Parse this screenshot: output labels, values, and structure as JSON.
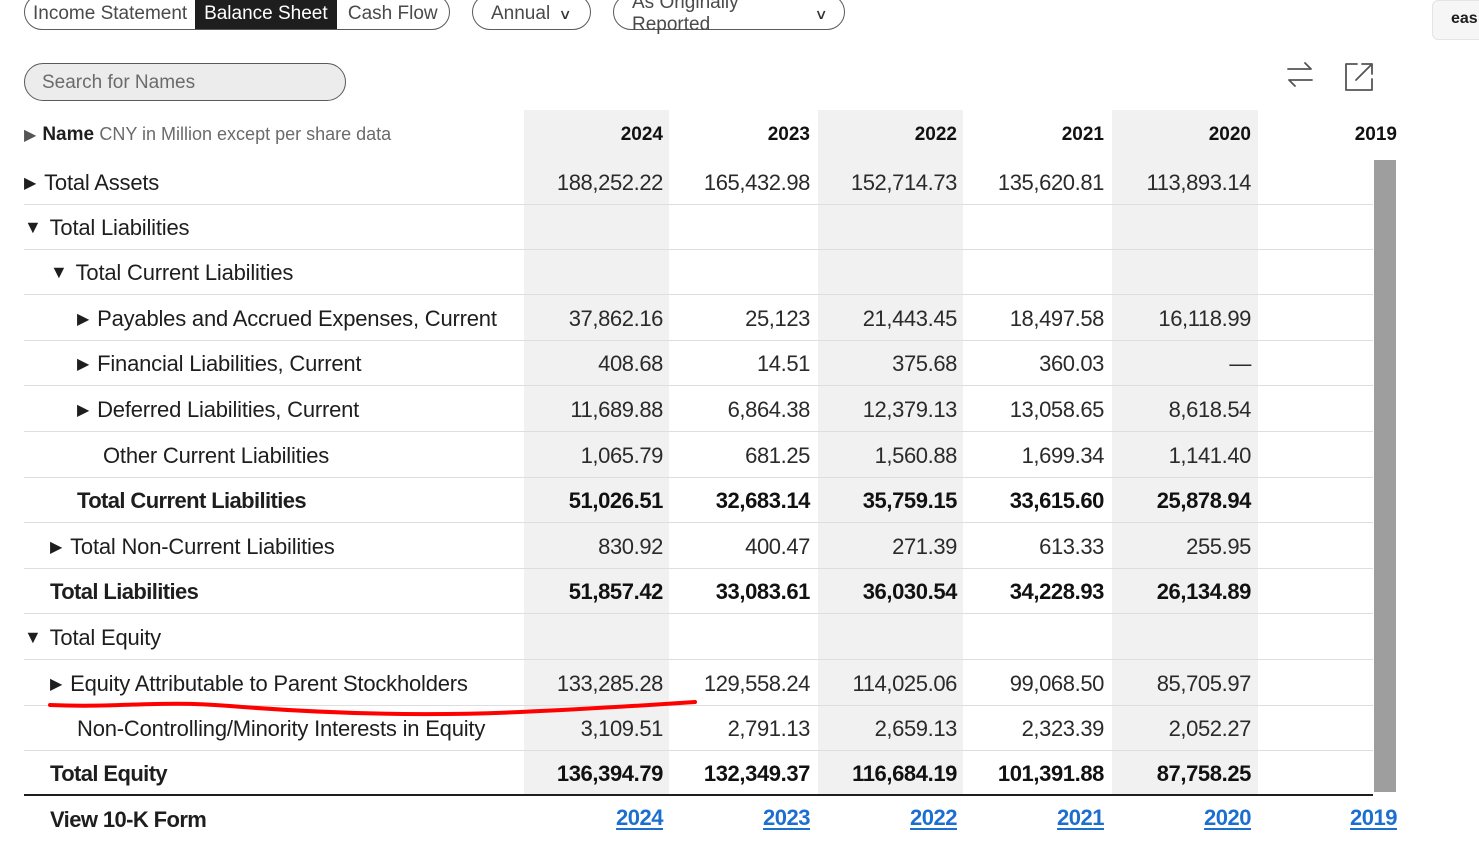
{
  "tabs": [
    {
      "label": "Income Statement",
      "active": false
    },
    {
      "label": "Balance Sheet",
      "active": true
    },
    {
      "label": "Cash Flow",
      "active": false
    }
  ],
  "period_dropdown": {
    "value": "Annual"
  },
  "report_dropdown": {
    "value": "As Originally Reported"
  },
  "corner_button": {
    "label": "eas"
  },
  "search": {
    "placeholder": "Search for Names"
  },
  "icons": {
    "swap": "swap-arrows-icon",
    "export": "external-link-icon"
  },
  "table": {
    "header": {
      "name_label": "Name",
      "units": "CNY in Million except per share data"
    },
    "years": [
      "2024",
      "2023",
      "2022",
      "2021",
      "2020",
      "2019"
    ],
    "rows": [
      {
        "label": "Total Assets",
        "values": [
          "188,252.22",
          "165,432.98",
          "152,714.73",
          "135,620.81",
          "113,893.14"
        ]
      },
      {
        "label": "Total Liabilities",
        "values": [
          "",
          "",
          "",
          "",
          ""
        ]
      },
      {
        "label": "Total Current Liabilities",
        "values": [
          "",
          "",
          "",
          "",
          ""
        ]
      },
      {
        "label": "Payables and Accrued Expenses, Current",
        "values": [
          "37,862.16",
          "25,123",
          "21,443.45",
          "18,497.58",
          "16,118.99"
        ]
      },
      {
        "label": "Financial Liabilities, Current",
        "values": [
          "408.68",
          "14.51",
          "375.68",
          "360.03",
          "—"
        ]
      },
      {
        "label": "Deferred Liabilities, Current",
        "values": [
          "11,689.88",
          "6,864.38",
          "12,379.13",
          "13,058.65",
          "8,618.54"
        ]
      },
      {
        "label": "Other Current Liabilities",
        "values": [
          "1,065.79",
          "681.25",
          "1,560.88",
          "1,699.34",
          "1,141.40"
        ]
      },
      {
        "label": "Total Current Liabilities",
        "values": [
          "51,026.51",
          "32,683.14",
          "35,759.15",
          "33,615.60",
          "25,878.94"
        ]
      },
      {
        "label": "Total Non-Current Liabilities",
        "values": [
          "830.92",
          "400.47",
          "271.39",
          "613.33",
          "255.95"
        ]
      },
      {
        "label": "Total Liabilities",
        "values": [
          "51,857.42",
          "33,083.61",
          "36,030.54",
          "34,228.93",
          "26,134.89"
        ]
      },
      {
        "label": "Total Equity",
        "values": [
          "",
          "",
          "",
          "",
          ""
        ]
      },
      {
        "label": "Equity Attributable to Parent Stockholders",
        "values": [
          "133,285.28",
          "129,558.24",
          "114,025.06",
          "99,068.50",
          "85,705.97"
        ]
      },
      {
        "label": "Non-Controlling/Minority Interests in Equity",
        "values": [
          "3,109.51",
          "2,791.13",
          "2,659.13",
          "2,323.39",
          "2,052.27"
        ]
      },
      {
        "label": "Total Equity",
        "values": [
          "136,394.79",
          "132,349.37",
          "116,684.19",
          "101,391.88",
          "87,758.25"
        ]
      }
    ],
    "footer": {
      "label": "View 10-K Form",
      "links": [
        "2024",
        "2023",
        "2022",
        "2021",
        "2020",
        "2019"
      ]
    }
  },
  "annotation": {
    "color": "#ff0000"
  }
}
